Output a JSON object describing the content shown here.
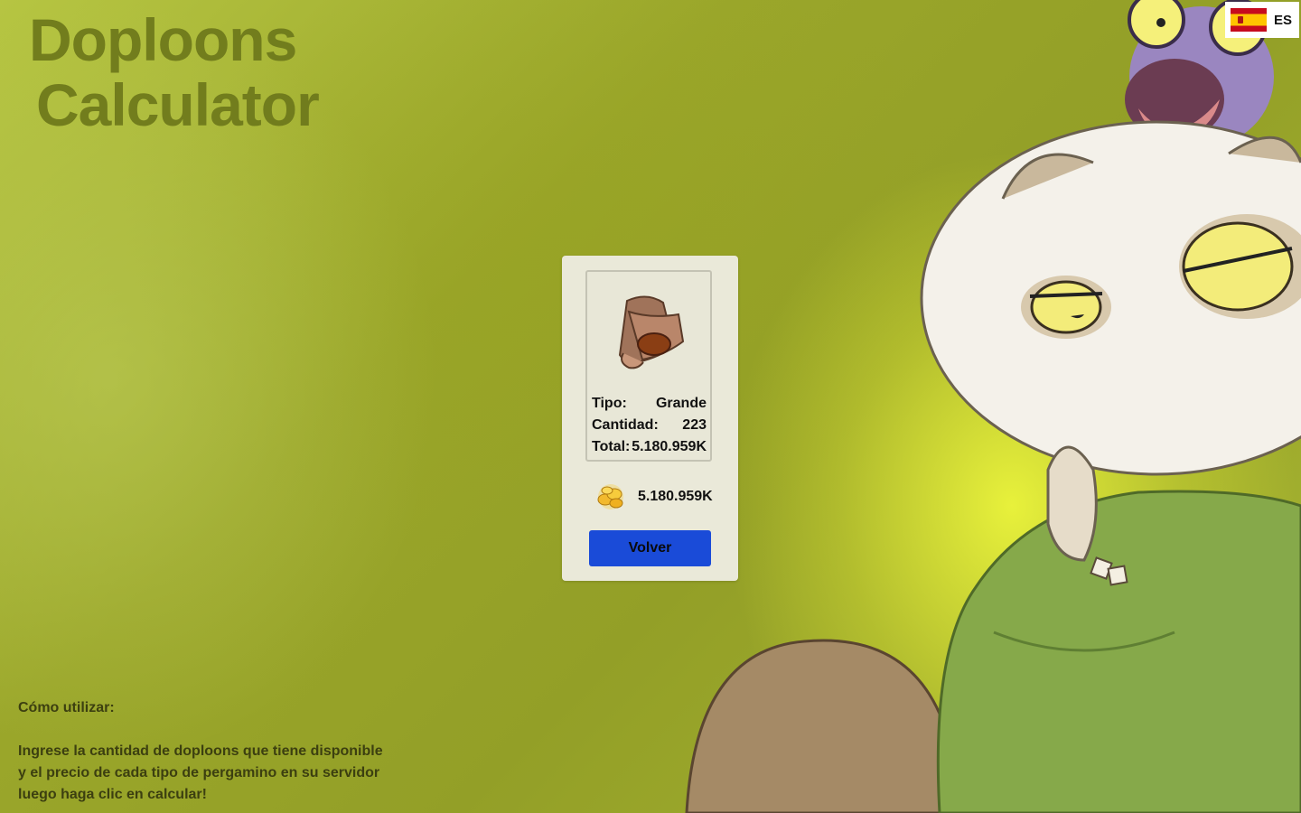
{
  "title": {
    "line1": "Doploons",
    "line2": "Calculator"
  },
  "language": {
    "code": "ES",
    "flag_icon": "spain-flag-icon"
  },
  "result_card": {
    "scroll_icon": "scroll-icon",
    "tipo_label": "Tipo:",
    "tipo_value": "Grande",
    "cantidad_label": "Cantidad:",
    "cantidad_value": "223",
    "total_label": "Total:",
    "total_value": "5.180.959K",
    "coins_icon": "doploons-coins-icon",
    "grand_total": "5.180.959K",
    "back_button": "Volver"
  },
  "help": {
    "heading": "Cómo utilizar:",
    "line1": "Ingrese la cantidad de doploons que tiene disponible",
    "line2": "y el precio de cada tipo de pergamino en su servidor",
    "line3": "luego haga clic en calcular!"
  },
  "colors": {
    "background": "#9aa62a",
    "title": "#6f7a1c",
    "card": "#eae9d9",
    "button": "#1a4bd8"
  }
}
